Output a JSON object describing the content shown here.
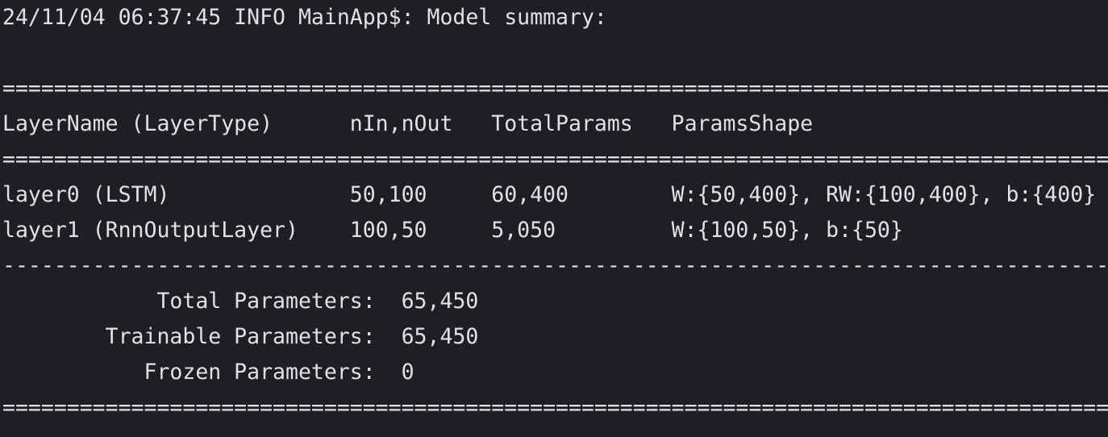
{
  "console": {
    "lines": [
      "24/11/04 06:37:45 INFO MainApp$: Model summary:",
      "==========================================================================================",
      "LayerName (LayerType)      nIn,nOut   TotalParams   ParamsShape",
      "==========================================================================================",
      "layer0 (LSTM)              50,100     60,400        W:{50,400}, RW:{100,400}, b:{400}",
      "layer1 (RnnOutputLayer)    100,50     5,050         W:{100,50}, b:{50}",
      "------------------------------------------------------------------------------------------",
      "            Total Parameters:  65,450",
      "        Trainable Parameters:  65,450",
      "           Frozen Parameters:  0",
      "=========================================================================================="
    ]
  },
  "colors": {
    "background": "#1e1f22",
    "text": "#dfe1e5"
  }
}
